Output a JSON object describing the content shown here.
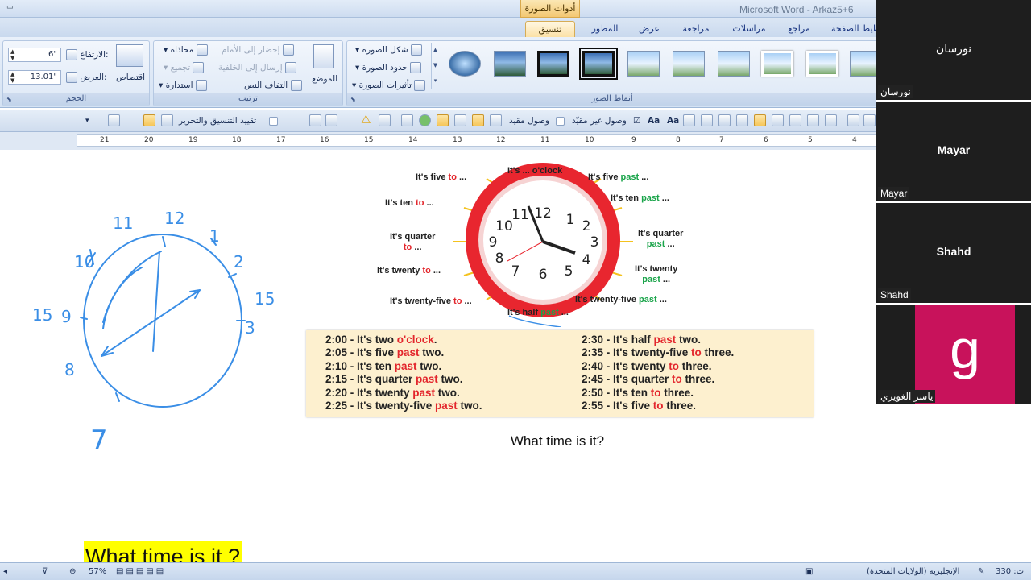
{
  "window": {
    "title": "Microsoft Word - Arkaz5+6",
    "context_tab": "أدوات الصورة"
  },
  "tabs": [
    "خطيط الصفحة",
    "مراجع",
    "مراسلات",
    "مراجعة",
    "عرض",
    "المطور",
    "تنسيق"
  ],
  "ribbon": {
    "size_group": {
      "label": "الحجم",
      "height_label": "الارتفاع:",
      "height_value": "6\"",
      "width_label": "العرض:",
      "width_value": "13.01\"",
      "crop": "اقتصاص"
    },
    "arrange_group": {
      "label": "ترتيب",
      "bring_front": "إحضار إلى الأمام",
      "send_back": "إرسال إلى الخلفية",
      "text_wrap": "التفاف النص",
      "align": "محاذاة",
      "group": "تجميع",
      "rotate": "استدارة",
      "position": "الموضع"
    },
    "styles_group": {
      "label": "أنماط الصور",
      "shape": "شكل الصورة",
      "border": "حدود الصورة",
      "effects": "تأثيرات الصورة"
    }
  },
  "toolbar": {
    "restrict": "تقييد التنسيق والتحرير",
    "linked": "وصول مقيد",
    "unlinked": "وصول غير مقيّد"
  },
  "ruler": {
    "numbers": [
      "21",
      "20",
      "19",
      "18",
      "17",
      "16",
      "15",
      "14",
      "13",
      "12",
      "11",
      "10",
      "9",
      "8",
      "7",
      "6",
      "5",
      "4"
    ]
  },
  "document": {
    "caption": "What time is it?",
    "heading_highlight": "What time is it ?",
    "handwritten_numbers": [
      "11",
      "12",
      "1",
      "2",
      "3",
      "10",
      "9",
      "8",
      "7",
      "15",
      "15"
    ],
    "clock_labels": {
      "top": "It's ... o'clock",
      "five_to": [
        "It's five ",
        "to",
        " ..."
      ],
      "five_past": [
        "It's five ",
        "past",
        " ..."
      ],
      "ten_to": [
        "It's ten ",
        "to",
        " ..."
      ],
      "ten_past": [
        "It's ten ",
        "past",
        " ..."
      ],
      "quarter_to": [
        "It's quarter",
        "to",
        " ..."
      ],
      "quarter_past": [
        "It's quarter",
        "past",
        " ..."
      ],
      "twenty_to": [
        "It's twenty ",
        "to",
        " ..."
      ],
      "twenty_past": [
        "It's twenty",
        "past",
        " ..."
      ],
      "twentyfive_to": [
        "It's twenty-five ",
        "to",
        " ..."
      ],
      "twentyfive_past": [
        "It's twenty-five ",
        "past",
        " ..."
      ],
      "half_past": [
        "It's half ",
        "past",
        " ..."
      ]
    },
    "clock_numbers": [
      "12",
      "1",
      "2",
      "3",
      "4",
      "5",
      "6",
      "7",
      "8",
      "9",
      "10",
      "11"
    ],
    "table_left": [
      [
        "2:00 - It's two ",
        "o'clock",
        "."
      ],
      [
        "2:05 - It's five ",
        "past",
        " two."
      ],
      [
        "2:10 - It's ten ",
        "past",
        " two."
      ],
      [
        "2:15 - It's quarter ",
        "past",
        " two."
      ],
      [
        "2:20 - It's twenty ",
        "past",
        " two."
      ],
      [
        "2:25 - It's twenty-five ",
        "past",
        " two."
      ]
    ],
    "table_right": [
      [
        "2:30 - It's half ",
        "past",
        " two."
      ],
      [
        "2:35 - It's twenty-five ",
        "to",
        " three."
      ],
      [
        "2:40 - It's twenty ",
        "to",
        " three."
      ],
      [
        "2:45 - It's quarter ",
        "to",
        " three."
      ],
      [
        "2:50 - It's ten ",
        "to",
        " three."
      ],
      [
        "2:55 - It's five ",
        "to",
        " three."
      ]
    ]
  },
  "status": {
    "page": "330 :ت",
    "language": "الإنجليزية (الولايات المتحدة)",
    "zoom": "57%"
  },
  "participants": [
    {
      "center": "نورسان",
      "corner": "نورسان"
    },
    {
      "center": "Mayar",
      "corner": "Mayar"
    },
    {
      "center": "Shahd",
      "corner": "Shahd"
    },
    {
      "center": "",
      "corner": "ياسر الغويري",
      "initial": "g"
    }
  ],
  "colors": {
    "to": "#e3262c",
    "past": "#1aa44a",
    "avatar": "#c8125b",
    "highlight": "#ffff00"
  }
}
